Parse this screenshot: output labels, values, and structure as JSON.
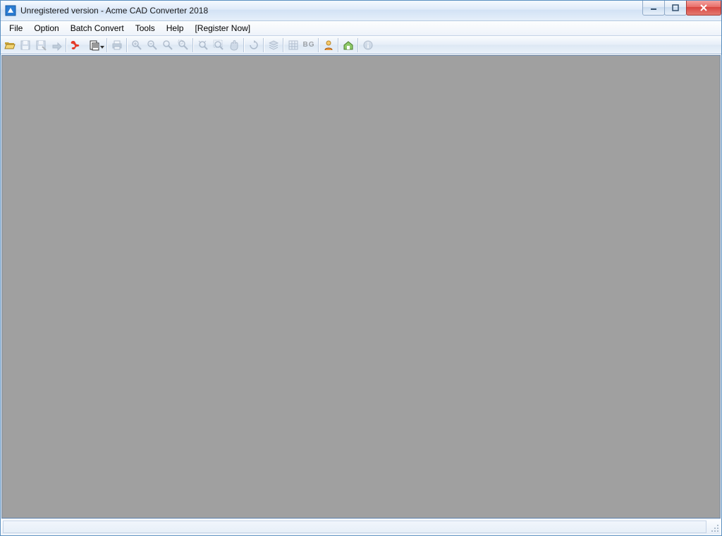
{
  "window": {
    "title": "Unregistered version - Acme CAD Converter 2018"
  },
  "menu": {
    "items": [
      "File",
      "Option",
      "Batch Convert",
      "Tools",
      "Help",
      "[Register Now]"
    ]
  },
  "toolbar": {
    "groups": [
      [
        {
          "name": "open-icon",
          "enabled": true
        },
        {
          "name": "save-icon",
          "enabled": false
        },
        {
          "name": "save-as-icon",
          "enabled": false
        },
        {
          "name": "export-icon",
          "enabled": false
        }
      ],
      [
        {
          "name": "pdf-icon",
          "enabled": true
        },
        {
          "name": "convert-icon",
          "enabled": true,
          "dropdown": true
        }
      ],
      [
        {
          "name": "print-icon",
          "enabled": false
        }
      ],
      [
        {
          "name": "zoom-in-icon",
          "enabled": false
        },
        {
          "name": "zoom-out-icon",
          "enabled": false
        },
        {
          "name": "zoom-icon",
          "enabled": false
        },
        {
          "name": "zoom-window-icon",
          "enabled": false
        }
      ],
      [
        {
          "name": "zoom-extents-icon",
          "enabled": false
        },
        {
          "name": "zoom-selection-icon",
          "enabled": false
        },
        {
          "name": "pan-icon",
          "enabled": false
        }
      ],
      [
        {
          "name": "rotate-icon",
          "enabled": false
        }
      ],
      [
        {
          "name": "layers-icon",
          "enabled": false
        }
      ],
      [
        {
          "name": "grid-icon",
          "enabled": false
        },
        {
          "name": "bg-icon",
          "enabled": false,
          "text": "BG"
        }
      ],
      [
        {
          "name": "user-icon",
          "enabled": true
        }
      ],
      [
        {
          "name": "home-icon",
          "enabled": true
        }
      ],
      [
        {
          "name": "about-icon",
          "enabled": false
        }
      ]
    ]
  },
  "status": {
    "text": ""
  }
}
